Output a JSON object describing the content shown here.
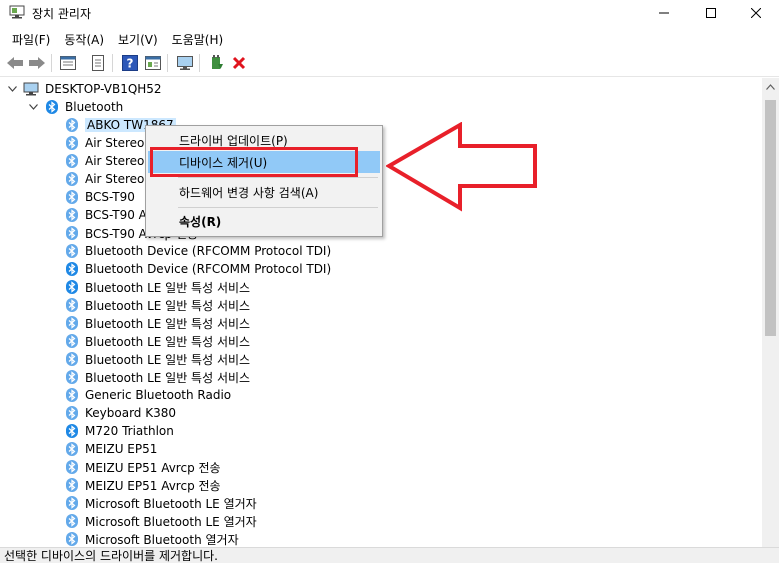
{
  "window": {
    "title": "장치 관리자"
  },
  "menu": [
    "파일(F)",
    "동작(A)",
    "보기(V)",
    "도움말(H)"
  ],
  "toolbar": {
    "icons": [
      "back-icon",
      "forward-icon",
      "properties-grid-icon",
      "document-icon",
      "help-icon",
      "view-icon",
      "monitor-icon",
      "update-driver-icon",
      "uninstall-icon"
    ]
  },
  "tree": {
    "root": "DESKTOP-VB1QH52",
    "category": "Bluetooth",
    "devices": [
      "ABKO TW1867",
      "Air Stereo",
      "Air Stereo",
      "Air Stereo",
      "BCS-T90",
      "BCS-T90 A",
      "BCS-T90 Avrcp 전송",
      "Bluetooth Device (RFCOMM Protocol TDI)",
      "Bluetooth Device (RFCOMM Protocol TDI)",
      "Bluetooth LE 일반 특성 서비스",
      "Bluetooth LE 일반 특성 서비스",
      "Bluetooth LE 일반 특성 서비스",
      "Bluetooth LE 일반 특성 서비스",
      "Bluetooth LE 일반 특성 서비스",
      "Bluetooth LE 일반 특성 서비스",
      "Generic Bluetooth Radio",
      "Keyboard K380",
      "M720 Triathlon",
      "MEIZU EP51",
      "MEIZU EP51 Avrcp 전송",
      "MEIZU EP51 Avrcp 전송",
      "Microsoft Bluetooth LE 열거자",
      "Microsoft Bluetooth LE 열거자",
      "Microsoft Bluetooth 열거자"
    ]
  },
  "context_menu": {
    "update_driver": "드라이버 업데이트(P)",
    "uninstall_device": "디바이스 제거(U)",
    "scan_hardware": "하드웨어 변경 사항 검색(A)",
    "properties": "속성(R)"
  },
  "status": "선택한 디바이스의 드라이버를 제거합니다.",
  "colors": {
    "accent_blue": "#1e88e5",
    "highlight": "#91c9f7",
    "selection": "#cce8ff",
    "annotation_red": "#e8202a"
  }
}
